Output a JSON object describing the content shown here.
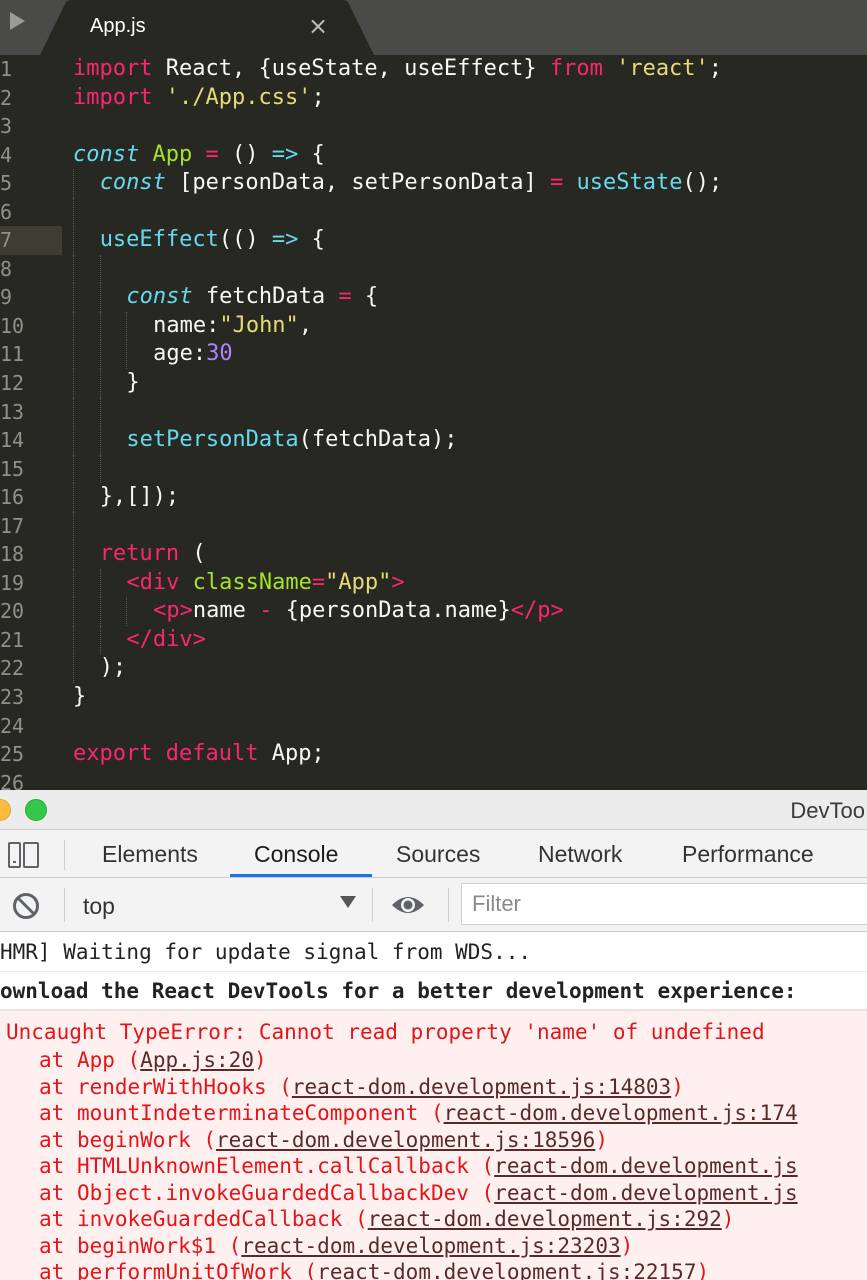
{
  "editor": {
    "tab_title": "App.js",
    "tab_close": "×",
    "highlight_line": 7,
    "lines": [
      {
        "n": "1",
        "indent": 0,
        "tokens": [
          [
            "kw",
            "import"
          ],
          [
            "pl",
            " React, {useState, useEffect} "
          ],
          [
            "kw",
            "from"
          ],
          [
            "pl",
            " "
          ],
          [
            "st",
            "'react'"
          ],
          [
            "pl",
            ";"
          ]
        ]
      },
      {
        "n": "2",
        "indent": 0,
        "tokens": [
          [
            "kw",
            "import"
          ],
          [
            "pl",
            " "
          ],
          [
            "st",
            "'./App.css'"
          ],
          [
            "pl",
            ";"
          ]
        ]
      },
      {
        "n": "3",
        "indent": 0,
        "tokens": []
      },
      {
        "n": "4",
        "indent": 0,
        "tokens": [
          [
            "sf",
            "const"
          ],
          [
            "pl",
            " "
          ],
          [
            "ent",
            "App"
          ],
          [
            "pl",
            " "
          ],
          [
            "kw",
            "="
          ],
          [
            "pl",
            " () "
          ],
          [
            "sf",
            "=>"
          ],
          [
            "pl",
            " {"
          ]
        ]
      },
      {
        "n": "5",
        "indent": 1,
        "tokens": [
          [
            "sf",
            "const"
          ],
          [
            "pl",
            " [personData, setPersonData] "
          ],
          [
            "kw",
            "="
          ],
          [
            "pl",
            " "
          ],
          [
            "fn",
            "useState"
          ],
          [
            "pl",
            "();"
          ]
        ]
      },
      {
        "n": "6",
        "indent": 1,
        "tokens": []
      },
      {
        "n": "7",
        "indent": 1,
        "tokens": [
          [
            "fn",
            "useEffect"
          ],
          [
            "pl",
            "(() "
          ],
          [
            "sf",
            "=>"
          ],
          [
            "pl",
            " {"
          ]
        ]
      },
      {
        "n": "8",
        "indent": 2,
        "tokens": []
      },
      {
        "n": "9",
        "indent": 2,
        "tokens": [
          [
            "sf",
            "const"
          ],
          [
            "pl",
            " fetchData "
          ],
          [
            "kw",
            "="
          ],
          [
            "pl",
            " {"
          ]
        ]
      },
      {
        "n": "10",
        "indent": 3,
        "tokens": [
          [
            "pl",
            "name:"
          ],
          [
            "st",
            "\"John\""
          ],
          [
            "pl",
            ","
          ]
        ]
      },
      {
        "n": "11",
        "indent": 3,
        "tokens": [
          [
            "pl",
            "age:"
          ],
          [
            "num",
            "30"
          ]
        ]
      },
      {
        "n": "12",
        "indent": 2,
        "tokens": [
          [
            "pl",
            "}"
          ]
        ]
      },
      {
        "n": "13",
        "indent": 2,
        "tokens": []
      },
      {
        "n": "14",
        "indent": 2,
        "tokens": [
          [
            "fn",
            "setPersonData"
          ],
          [
            "pl",
            "(fetchData);"
          ]
        ]
      },
      {
        "n": "15",
        "indent": 2,
        "tokens": []
      },
      {
        "n": "16",
        "indent": 1,
        "tokens": [
          [
            "pl",
            "},[]);"
          ]
        ]
      },
      {
        "n": "17",
        "indent": 1,
        "tokens": []
      },
      {
        "n": "18",
        "indent": 1,
        "tokens": [
          [
            "kw",
            "return"
          ],
          [
            "pl",
            " ("
          ]
        ]
      },
      {
        "n": "19",
        "indent": 2,
        "tokens": [
          [
            "kw",
            "<"
          ],
          [
            "kw",
            "div"
          ],
          [
            "pl",
            " "
          ],
          [
            "ent",
            "className"
          ],
          [
            "kw",
            "="
          ],
          [
            "st",
            "\"App\""
          ],
          [
            "kw",
            ">"
          ]
        ]
      },
      {
        "n": "20",
        "indent": 3,
        "tokens": [
          [
            "kw",
            "<"
          ],
          [
            "kw",
            "p"
          ],
          [
            "kw",
            ">"
          ],
          [
            "pl",
            "name "
          ],
          [
            "kw",
            "-"
          ],
          [
            "pl",
            " {personData.name}"
          ],
          [
            "kw",
            "</"
          ],
          [
            "kw",
            "p"
          ],
          [
            "kw",
            ">"
          ]
        ]
      },
      {
        "n": "21",
        "indent": 2,
        "tokens": [
          [
            "kw",
            "</"
          ],
          [
            "kw",
            "div"
          ],
          [
            "kw",
            ">"
          ]
        ]
      },
      {
        "n": "22",
        "indent": 1,
        "tokens": [
          [
            "pl",
            ");"
          ]
        ]
      },
      {
        "n": "23",
        "indent": 0,
        "tokens": [
          [
            "pl",
            "}"
          ]
        ]
      },
      {
        "n": "24",
        "indent": 0,
        "tokens": []
      },
      {
        "n": "25",
        "indent": 0,
        "tokens": [
          [
            "kw",
            "export"
          ],
          [
            "pl",
            " "
          ],
          [
            "kw",
            "default"
          ],
          [
            "pl",
            " App;"
          ]
        ]
      },
      {
        "n": "26",
        "indent": 0,
        "tokens": []
      }
    ]
  },
  "colors": {
    "editor_bg": "#272822",
    "keyword": "#f92672",
    "string": "#e6db74",
    "storage": "#66d9ef",
    "entity": "#a6e22e",
    "number": "#ae81ff",
    "error_text": "#e3141a",
    "active_tab": "#1a73e8"
  },
  "devtools": {
    "window_title": "DevToo",
    "tabs": [
      "Elements",
      "Console",
      "Sources",
      "Network",
      "Performance"
    ],
    "active_tab": "Console",
    "context": "top",
    "filter_placeholder": "Filter",
    "icons": {
      "device": "device-toggle-icon",
      "clear": "clear-console-icon",
      "dropdown": "dropdown-arrow-icon",
      "eye": "eye-icon"
    }
  },
  "console": {
    "hmr_message": "HMR] Waiting for update signal from WDS...",
    "devtools_message": "ownload the React DevTools for a better development experience: ",
    "error_message": "Uncaught TypeError: Cannot read property 'name' of undefined",
    "stack": [
      {
        "fn": "App",
        "loc": "App.js:20",
        "close": ")"
      },
      {
        "fn": "renderWithHooks",
        "loc": "react-dom.development.js:14803",
        "close": ")"
      },
      {
        "fn": "mountIndeterminateComponent",
        "loc": "react-dom.development.js:174",
        "close": ""
      },
      {
        "fn": "beginWork",
        "loc": "react-dom.development.js:18596",
        "close": ")"
      },
      {
        "fn": "HTMLUnknownElement.callCallback",
        "loc": "react-dom.development.js",
        "close": ""
      },
      {
        "fn": "Object.invokeGuardedCallbackDev",
        "loc": "react-dom.development.js",
        "close": ""
      },
      {
        "fn": "invokeGuardedCallback",
        "loc": "react-dom.development.js:292",
        "close": ")"
      },
      {
        "fn": "beginWork$1",
        "loc": "react-dom.development.js:23203",
        "close": ")"
      },
      {
        "fn": "performUnitOfWork",
        "loc": "react-dom.development.js:22157",
        "close": ")"
      }
    ]
  }
}
